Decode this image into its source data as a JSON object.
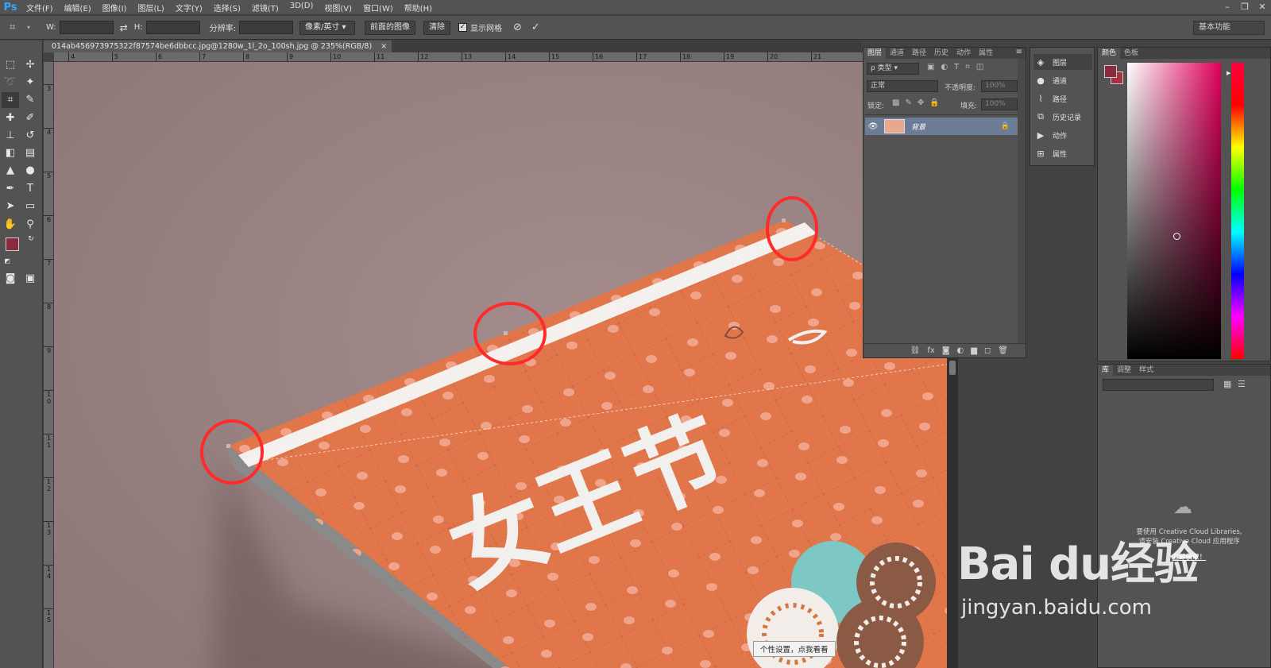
{
  "app": {
    "logo": "Ps"
  },
  "menu": [
    "文件(F)",
    "编辑(E)",
    "图像(I)",
    "图层(L)",
    "文字(Y)",
    "选择(S)",
    "滤镜(T)",
    "3D(D)",
    "视图(V)",
    "窗口(W)",
    "帮助(H)"
  ],
  "window_controls": {
    "minimize": "–",
    "restore": "❐",
    "close": "✕"
  },
  "options": {
    "w_label": "W:",
    "h_label": "H:",
    "swap_icon": "⇄",
    "resolution_label": "分辨率:",
    "unit_select": "像素/英寸",
    "front_image_button": "前面的图像",
    "clear_button": "清除",
    "show_grid_label": "显示网格",
    "show_grid_checked": true,
    "cancel_icon": "⃠",
    "commit_icon": "✓",
    "workspace": "基本功能"
  },
  "document": {
    "tab_title": "014ab456973975322f87574be6dbbcc.jpg@1280w_1l_2o_100sh.jpg @ 235%(RGB/8)",
    "close": "×",
    "ruler_top": [
      "4",
      "5",
      "6",
      "7",
      "8",
      "9",
      "10",
      "11",
      "12",
      "13",
      "14",
      "15",
      "16",
      "17",
      "18",
      "19",
      "20",
      "21"
    ],
    "ruler_left": [
      "3",
      "4",
      "5",
      "6",
      "7",
      "8",
      "9",
      "1\n0",
      "1\n1",
      "1\n2",
      "1\n3",
      "1\n4",
      "1\n5"
    ],
    "artwork_text": "女王节",
    "tooltip": "个性设置，点我看看"
  },
  "layers_panel": {
    "tabs": [
      "图层",
      "通道",
      "路径",
      "历史",
      "动作",
      "属性"
    ],
    "menu_icon": "≡",
    "kind_filter": "ρ 类型",
    "blend_mode": "正常",
    "opacity_label": "不透明度:",
    "opacity_value": "100%",
    "lock_label": "锁定:",
    "fill_label": "填充:",
    "fill_value": "100%",
    "layers": [
      {
        "name": "背景",
        "visible": true,
        "locked": true
      }
    ],
    "footer_icons": [
      "link-icon",
      "fx-icon",
      "mask-icon",
      "adjustment-icon",
      "folder-icon",
      "new-layer-icon",
      "trash-icon"
    ],
    "footer_glyphs": [
      "⛓",
      "fx",
      "◙",
      "◐",
      "▆",
      "◻",
      "🗑"
    ]
  },
  "collapsed_panels": [
    "图层",
    "通道",
    "路径",
    "历史记录",
    "动作",
    "属性"
  ],
  "color_panel": {
    "tabs": [
      "颜色",
      "色板"
    ],
    "foreground": "#8a2a3c",
    "background": "#a63244"
  },
  "library_panel": {
    "tabs": [
      "库",
      "调整",
      "样式"
    ],
    "message": [
      "要使用 Creative Cloud Libraries,",
      "请安装 Creative Cloud 应用程序"
    ],
    "link": "立即获取！"
  },
  "watermark": {
    "main": "Bai du经验",
    "sub": "jingyan.baidu.com"
  },
  "colors": {
    "panel": "#535353",
    "canvas_bg": "#9b8282",
    "card": "#e0764a",
    "highlight_circle": "#ff2a2a",
    "layer_selected": "#6c7c96"
  }
}
